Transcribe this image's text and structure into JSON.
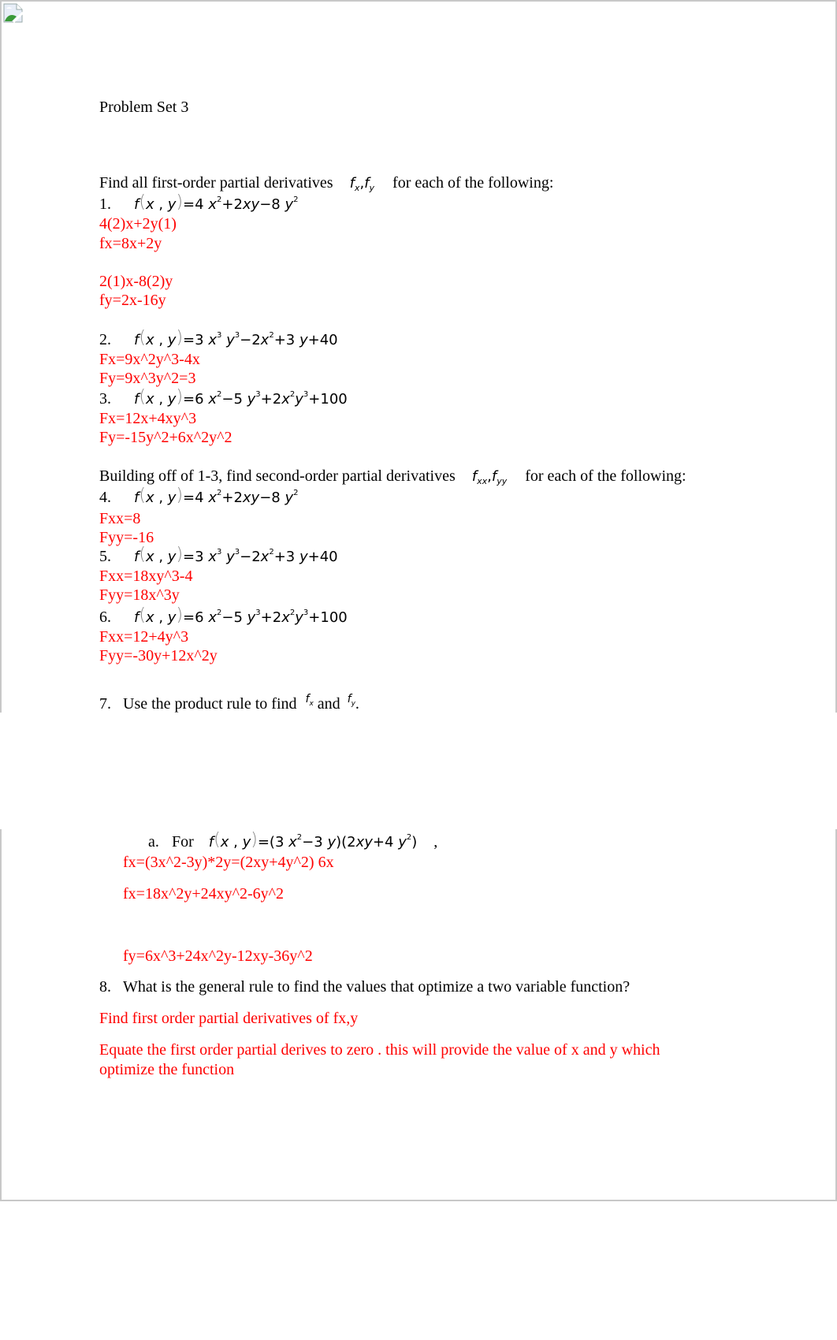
{
  "document": {
    "broken_image_icon": "broken-image-icon",
    "title": "Problem Set 3",
    "section1": {
      "intro_before": "Find all first-order partial derivatives",
      "intro_math_f1": "f",
      "intro_math_sub1": "x",
      "intro_math_sep": ",",
      "intro_math_f2": "f",
      "intro_math_sub2": "y",
      "intro_after": "for each of the following:",
      "problems": [
        {
          "number": "1.",
          "equation": [
            "f",
            "x , y",
            "=4",
            "x",
            "2",
            "+2",
            "xy",
            "−8",
            "y",
            "2"
          ],
          "answers": [
            "4(2)x+2y(1)",
            "fx=8x+2y",
            "",
            "2(1)x-8(2)y",
            "fy=2x-16y"
          ]
        },
        {
          "number": "2.",
          "answers": [
            "Fx=9x^2y^3-4x",
            "Fy=9x^3y^2=3"
          ]
        },
        {
          "number": "3.",
          "answers": [
            "Fx=12x+4xy^3",
            "Fy=-15y^2+6x^2y^2"
          ]
        }
      ]
    },
    "section2": {
      "intro_before": "Building off of 1-3, find second-order partial derivatives",
      "intro_math_sub1": "xx",
      "intro_math_sub2": "yy",
      "intro_after": "for each of the following:",
      "problems": [
        {
          "number": "4.",
          "answers": [
            "Fxx=8",
            "Fyy=-16"
          ]
        },
        {
          "number": "5.",
          "answers": [
            "Fxx=18xy^3-4",
            "Fyy=18x^3y"
          ]
        },
        {
          "number": "6.",
          "answers": [
            "Fxx=12+4y^3",
            "Fyy=-30y+12x^2y"
          ]
        }
      ]
    },
    "equations": {
      "eq1": {
        "lead": "=4",
        "rest1": "+2",
        "xy": "xy",
        "rest2": "−8"
      },
      "eq2": {
        "lead": "=3",
        "minus": "−2",
        "plus": "+3",
        "plus2": "+",
        "const": "40"
      },
      "eq3": {
        "lead": "=6",
        "minus": "−5",
        "plus": "+2",
        "plus2": "+",
        "const": "100"
      },
      "fx": "f",
      "x": "x",
      "y": "y",
      "comma": ",",
      "sup2": "2",
      "sup3": "3"
    },
    "question7": {
      "number": "7.",
      "text_before": "Use the product rule to find",
      "and": "and",
      "period": ".",
      "sub_item": {
        "label": "a.",
        "for": "For",
        "eq_lead": "=(3",
        "eq_mid": "−3",
        "eq_close": ")(2",
        "eq_plus": "+4",
        "eq_end": ")",
        "trailing": ","
      },
      "answers": [
        "fx=(3x^2-3y)*2y=(2xy+4y^2) 6x",
        "fx=18x^2y+24xy^2-6y^2",
        "fy=6x^3+24x^2y-12xy-36y^2"
      ]
    },
    "question8": {
      "number": "8.",
      "text": "What is the general rule to find the values that optimize a two variable function?",
      "answers": [
        "Find first order partial derivatives of fx,y",
        "Equate the first order partial derives to zero . this will provide the value of x and y which",
        "optimize the function"
      ]
    },
    "colors": {
      "answer": "#ff0000",
      "text": "#000000",
      "page_border": "#c8c8c8"
    }
  }
}
